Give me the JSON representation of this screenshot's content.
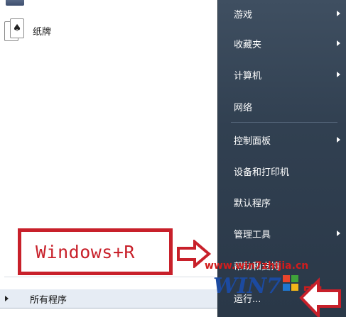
{
  "left_pane": {
    "programs": [
      {
        "label": "纸牌",
        "icon": "solitaire-cards-icon"
      }
    ],
    "all_programs_label": "所有程序"
  },
  "right_pane": {
    "items": [
      {
        "label": "游戏",
        "has_submenu": true
      },
      {
        "label": "收藏夹",
        "has_submenu": true
      },
      {
        "label": "计算机",
        "has_submenu": true
      },
      {
        "label": "网络",
        "has_submenu": false
      },
      {
        "label": "控制面板",
        "has_submenu": true
      },
      {
        "label": "设备和打印机",
        "has_submenu": false
      },
      {
        "label": "默认程序",
        "has_submenu": false
      },
      {
        "label": "管理工具",
        "has_submenu": true
      },
      {
        "label": "帮助和支持",
        "has_submenu": false
      }
    ],
    "run_label": "运行..."
  },
  "annotation": {
    "text": "Windows+R",
    "color": "#c8202a"
  },
  "watermark": {
    "url": "www.win7zhijia.cn",
    "brand": "WIN7",
    "brand_suffix": "家"
  },
  "colors": {
    "right_pane_bg": "#314051",
    "annotation_red": "#c8202a",
    "watermark_blue": "#1c4aa0"
  }
}
